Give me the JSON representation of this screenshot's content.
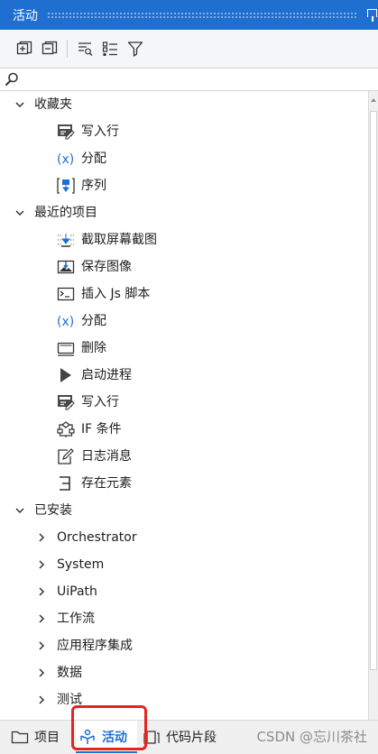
{
  "panel": {
    "title": "活动",
    "pin_icon": "pin-icon"
  },
  "toolbar": {
    "buttons": [
      {
        "name": "expand-all-icon"
      },
      {
        "name": "collapse-all-icon"
      },
      {
        "name": "sort-icon"
      },
      {
        "name": "list-view-icon"
      },
      {
        "name": "filter-icon"
      }
    ]
  },
  "search": {
    "placeholder": "",
    "value": ""
  },
  "tree": {
    "favorites": {
      "label": "收藏夹",
      "items": [
        {
          "label": "写入行",
          "icon": "write-line-icon"
        },
        {
          "label": "分配",
          "icon": "assign-icon"
        },
        {
          "label": "序列",
          "icon": "sequence-icon"
        }
      ]
    },
    "recent": {
      "label": "最近的项目",
      "items": [
        {
          "label": "截取屏幕截图",
          "icon": "screenshot-icon"
        },
        {
          "label": "保存图像",
          "icon": "save-image-icon"
        },
        {
          "label": "插入 Js 脚本",
          "icon": "js-script-icon"
        },
        {
          "label": "分配",
          "icon": "assign-icon"
        },
        {
          "label": "删除",
          "icon": "delete-icon"
        },
        {
          "label": "启动进程",
          "icon": "start-process-icon"
        },
        {
          "label": "写入行",
          "icon": "write-line-icon"
        },
        {
          "label": "IF 条件",
          "icon": "if-icon"
        },
        {
          "label": "日志消息",
          "icon": "log-message-icon"
        },
        {
          "label": "存在元素",
          "icon": "element-exists-icon"
        }
      ]
    },
    "installed": {
      "label": "已安装",
      "items": [
        {
          "label": "Orchestrator"
        },
        {
          "label": "System"
        },
        {
          "label": "UiPath"
        },
        {
          "label": "工作流"
        },
        {
          "label": "应用程序集成"
        },
        {
          "label": "数据"
        },
        {
          "label": "测试"
        }
      ]
    }
  },
  "tabs": [
    {
      "label": "项目",
      "icon": "folder-icon"
    },
    {
      "label": "活动",
      "icon": "activities-icon",
      "active": true
    },
    {
      "label": "代码片段",
      "icon": "snippets-icon"
    }
  ],
  "watermark": "CSDN @忘川茶社",
  "colors": {
    "accent": "#1f6fd1",
    "highlight": "#e5261e"
  }
}
